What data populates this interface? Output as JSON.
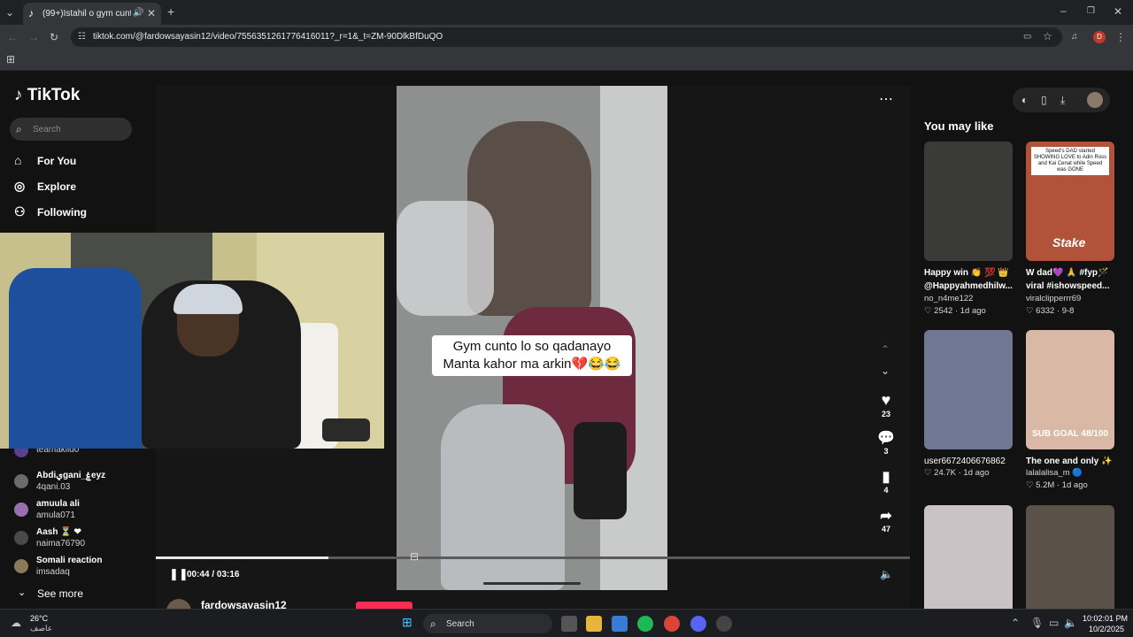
{
  "browser": {
    "tab_title": "(99+)Istahil o gym cunto ka",
    "url": "tiktok.com/@fardowsayasin12/video/7556351261776416011?_r=1&_t=ZM-90DlkBfDuQO",
    "profile_initial": "D"
  },
  "sidebar": {
    "logo": "TikTok",
    "search_placeholder": "Search",
    "nav": [
      {
        "label": "For You",
        "icon": "home-icon"
      },
      {
        "label": "Explore",
        "icon": "compass-icon"
      },
      {
        "label": "Following",
        "icon": "following-icon"
      }
    ],
    "accounts": [
      {
        "name": "Abdiيgani_ۼeyz",
        "user": "4qani.03"
      },
      {
        "name": "amuula ali",
        "user": "amula071"
      },
      {
        "name": "Aash ⏳ ❤",
        "user": "naima76790"
      },
      {
        "name": "Somali reaction",
        "user": "imsadaq"
      }
    ],
    "partial_account_user": "teamakiid0",
    "see_more": "See more"
  },
  "video": {
    "caption_line1": "Gym cunto lo so qadanayo",
    "caption_line2": "Manta kahor ma arkin💔😂😂",
    "time": "00:44 / 03:16",
    "progress": 0.229,
    "author_partial": "fardowsayasin12"
  },
  "actions": {
    "likes": "23",
    "comments": "3",
    "saves": "4",
    "shares": "47"
  },
  "recommendations": {
    "heading": "You may like",
    "cards": [
      {
        "title1": "Happy win 👏 💯 👑",
        "title2": "@Happyahmedhilw...",
        "author": "no_n4me122",
        "stats": "♡ 2542 · 1d ago",
        "thumb_color": "#3a3a38"
      },
      {
        "title1": "W dad💜 🙏 #fyp🪄",
        "title2": "viral #ishowspeed...",
        "author": "viralclipperrr69",
        "stats": "♡ 6332 · 9-8",
        "thumb_color": "#b0533a"
      },
      {
        "title1": "user6672406676862",
        "title2": "",
        "author": "",
        "stats": "♡ 24.7K · 1d ago",
        "thumb_color": "#6f7795"
      },
      {
        "title1": "The one and only ✨",
        "title2": "",
        "author": "lalalalisa_m 🔵",
        "stats": "♡ 5.2M · 1d ago",
        "thumb_color": "#d9b9a6"
      }
    ],
    "bottom_thumbs": [
      "#c9c3c6",
      "#5a5249"
    ],
    "thumb_overlay_top_right": "Speed's DAD started SHOWING LOVE to Adin Ross and Kai Cenat while Speed was GONE",
    "thumb_overlay_stake": "Stake",
    "thumb_overlay_goal": "SUB GOAL 48/100"
  },
  "taskbar": {
    "weather_temp": "26°C",
    "weather_desc": "عاصف",
    "search_label": "Search",
    "clock_time": "10:02:01 PM",
    "clock_date": "10/2/2025"
  },
  "colors": {
    "accent_red": "#fe2c55",
    "page_bg": "#121212",
    "chrome_bg": "#35363a"
  }
}
